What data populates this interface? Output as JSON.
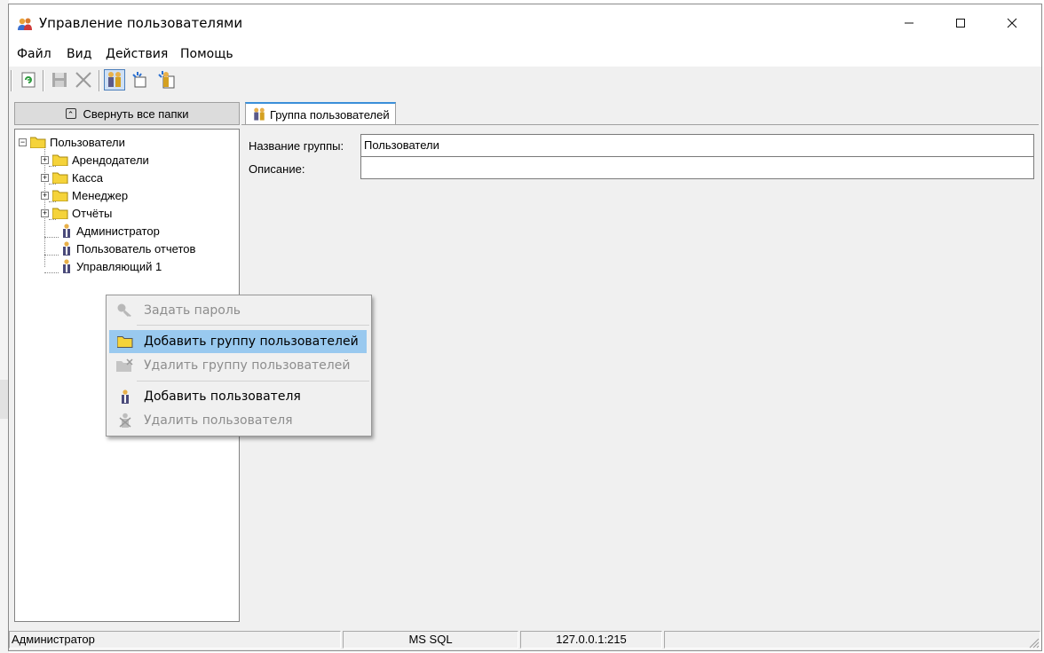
{
  "window": {
    "title": "Управление пользователями"
  },
  "menu": [
    "Файл",
    "Вид",
    "Действия",
    "Помощь"
  ],
  "toolbar": {
    "buttons": [
      "refresh-icon",
      "save-icon",
      "delete-icon",
      "users-icon",
      "add-folder-icon",
      "add-user-icon"
    ]
  },
  "left_pane": {
    "collapse_label": "Свернуть все папки"
  },
  "tree": {
    "root": "Пользователи",
    "groups": [
      "Арендодатели",
      "Касса",
      "Менеджер",
      "Отчёты"
    ],
    "users": [
      "Администратор",
      "Пользователь отчетов",
      "Управляющий 1"
    ]
  },
  "tab": {
    "label": "Группа пользователей"
  },
  "form": {
    "name_label": "Название группы:",
    "name_value": "Пользователи",
    "desc_label": "Описание:",
    "desc_value": ""
  },
  "context_menu": {
    "set_password": "Задать пароль",
    "add_group": "Добавить группу пользователей",
    "delete_group": "Удалить группу пользователей",
    "add_user": "Добавить пользователя",
    "delete_user": "Удалить пользователя"
  },
  "status": {
    "user": "Администратор",
    "db": "MS SQL",
    "address": "127.0.0.1:215"
  },
  "colors": {
    "highlight": "#99c9ef",
    "tab_accent": "#3a8fd9",
    "folder": "#f5d33a"
  }
}
